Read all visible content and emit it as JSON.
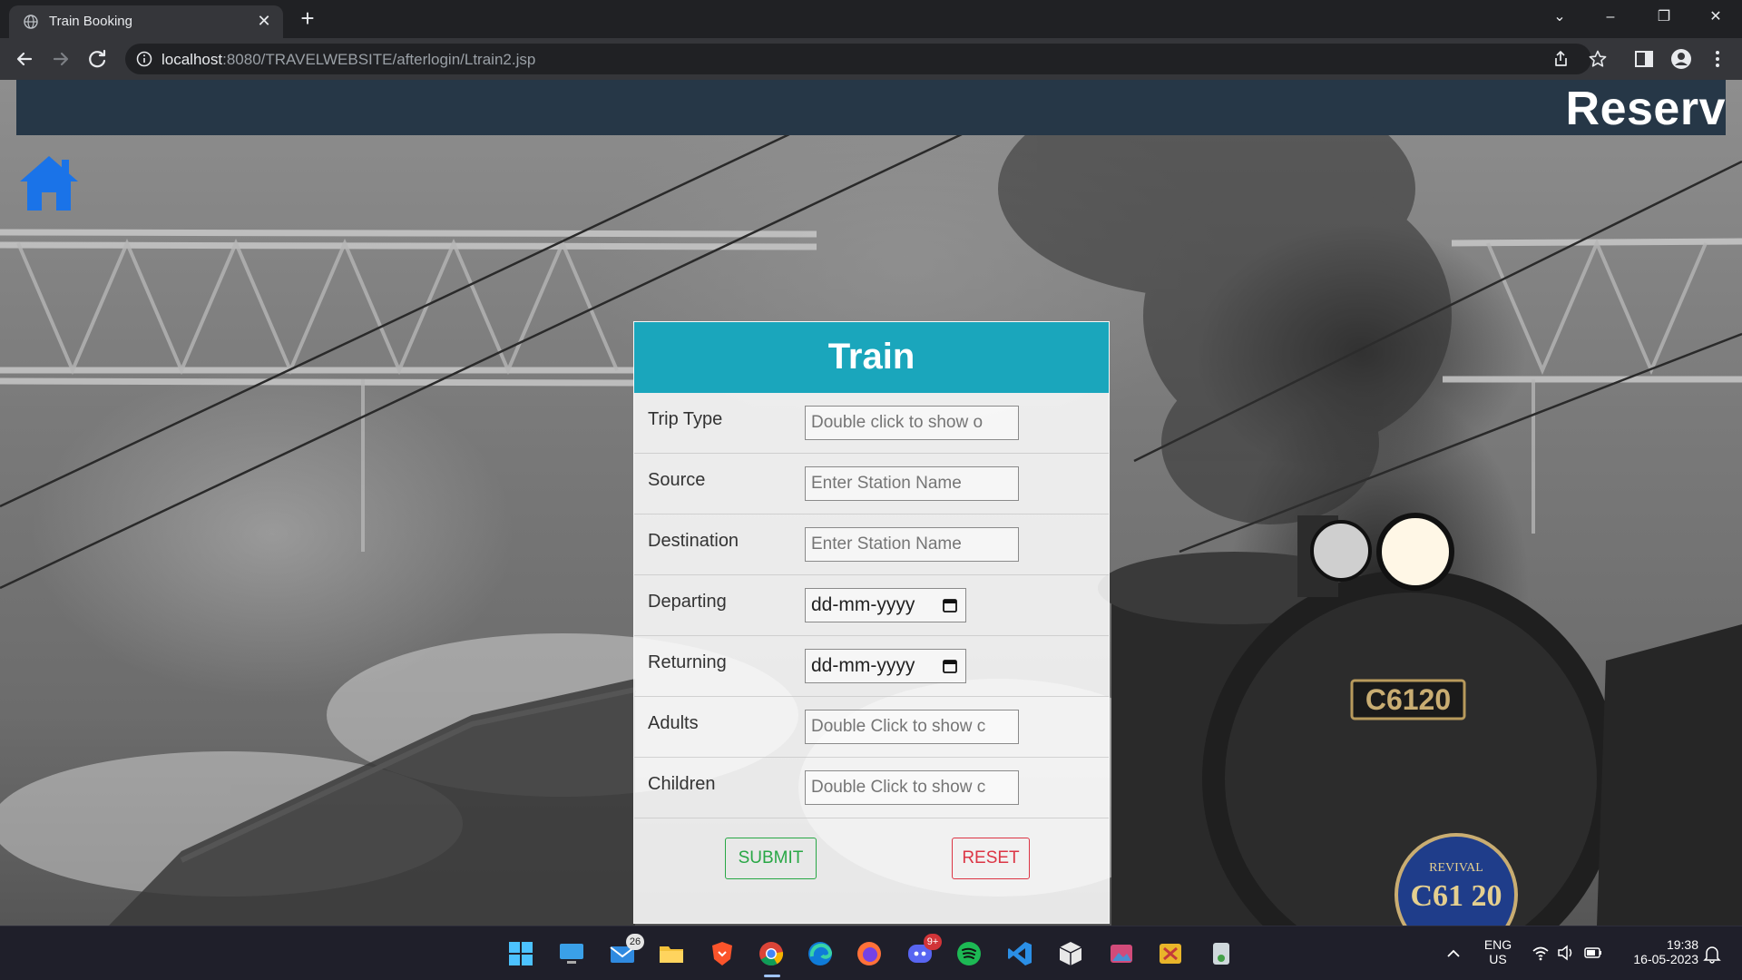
{
  "browser": {
    "tab_title": "Train Booking",
    "url_host": "localhost",
    "url_rest": ":8080/TRAVELWEBSITE/afterlogin/Ltrain2.jsp"
  },
  "page": {
    "banner_text": "Reserv",
    "form": {
      "title": "Train",
      "rows": [
        {
          "label": "Trip Type",
          "placeholder": "Double click to show o"
        },
        {
          "label": "Source",
          "placeholder": "Enter Station Name"
        },
        {
          "label": "Destination",
          "placeholder": "Enter Station Name"
        },
        {
          "label": "Departing",
          "value": "dd-mm-yyyy"
        },
        {
          "label": "Returning",
          "value": "dd-mm-yyyy"
        },
        {
          "label": "Adults",
          "placeholder": "Double Click to show c"
        },
        {
          "label": "Children",
          "placeholder": "Double Click to show c"
        }
      ],
      "submit_label": "SUBMIT",
      "reset_label": "RESET"
    },
    "background_locomotive_number": "C6120",
    "background_badge_text": "REVIVAL C61 20"
  },
  "taskbar": {
    "mail_badge": "26",
    "discord_badge": "9+",
    "language": "ENG",
    "region": "US",
    "time": "19:38",
    "date": "16-05-2023"
  },
  "colors": {
    "header_teal": "#1aa6bc",
    "banner_navy": "#263747",
    "home_icon_blue": "#1a73e8",
    "submit_green": "#28a745",
    "reset_red": "#dc3545"
  }
}
